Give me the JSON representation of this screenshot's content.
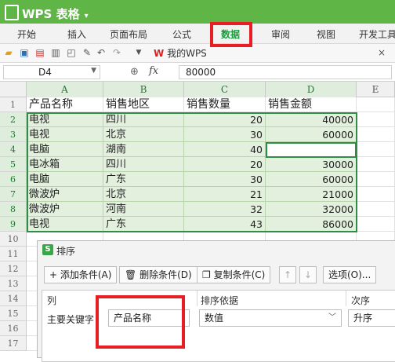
{
  "app": {
    "title": "WPS 表格",
    "colors": {
      "brand_green": "#5fb546",
      "accent_red": "#e81e25",
      "selection_green": "#2f8d46"
    }
  },
  "menu": {
    "items": [
      "开始",
      "插入",
      "页面布局",
      "公式",
      "数据",
      "审阅",
      "视图",
      "开发工具"
    ],
    "active_index": 4
  },
  "toolbar": {
    "doc_tab_label": "我的WPS",
    "close_glyph": "×"
  },
  "formula_bar": {
    "cell_ref": "D4",
    "fx_label": "fx",
    "value": "80000"
  },
  "sheet": {
    "columns": [
      "A",
      "B",
      "C",
      "D",
      "E"
    ],
    "selected_columns": [
      "A",
      "B",
      "C",
      "D"
    ],
    "row_numbers": [
      "1",
      "2",
      "3",
      "4",
      "5",
      "6",
      "7",
      "8",
      "9",
      "10",
      "11",
      "12",
      "13",
      "14",
      "15",
      "16",
      "17"
    ],
    "headers": [
      "产品名称",
      "销售地区",
      "销售数量",
      "销售金额"
    ],
    "rows": [
      [
        "电视",
        "四川",
        "20",
        "40000"
      ],
      [
        "电视",
        "北京",
        "30",
        "60000"
      ],
      [
        "电脑",
        "湖南",
        "40",
        "80000"
      ],
      [
        "电冰箱",
        "四川",
        "20",
        "30000"
      ],
      [
        "电脑",
        "广东",
        "30",
        "60000"
      ],
      [
        "微波炉",
        "北京",
        "21",
        "21000"
      ],
      [
        "微波炉",
        "河南",
        "32",
        "32000"
      ],
      [
        "电视",
        "广东",
        "43",
        "86000"
      ]
    ]
  },
  "sort_dialog": {
    "title": "排序",
    "add_condition": "+ 添加条件(A)",
    "delete_condition": "删除条件(D)",
    "copy_condition": "复制条件(C)",
    "options": "选项(O)...",
    "col_header": "列",
    "sort_by_header": "排序依据",
    "order_header": "次序",
    "primary_key_label": "主要关键字",
    "primary_key_value": "产品名称",
    "sort_by_value": "数值",
    "order_value": "升序"
  }
}
